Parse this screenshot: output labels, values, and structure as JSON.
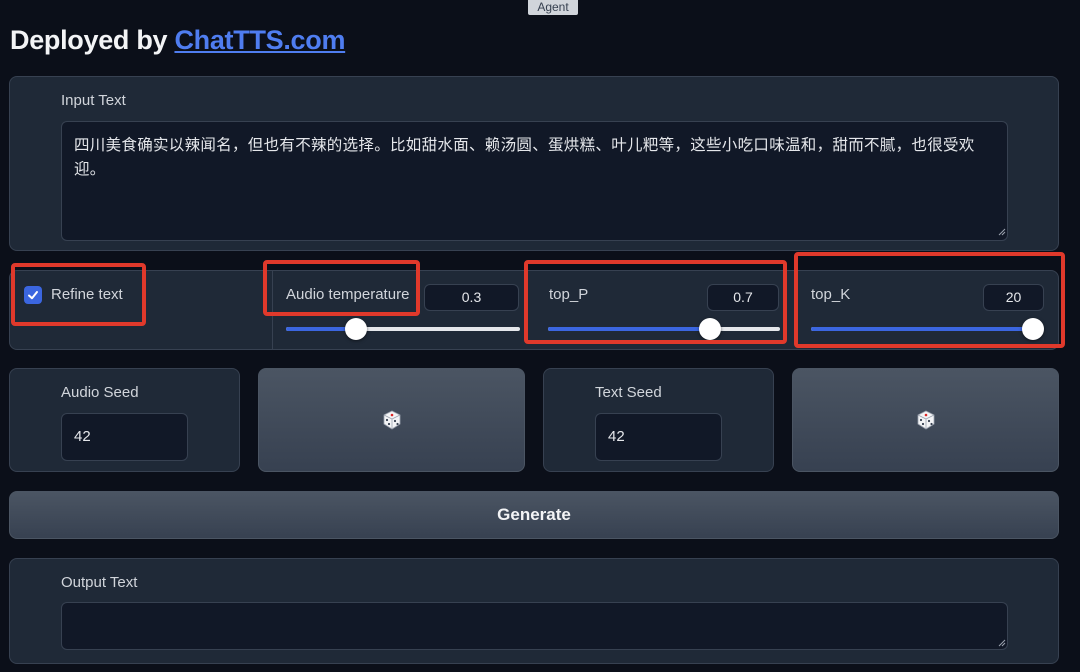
{
  "window": {
    "agent_tag": "Agent",
    "title_prefix": "Deployed by ",
    "title_link": "ChatTTS.com"
  },
  "input": {
    "label": "Input Text",
    "value": "四川美食确实以辣闻名，但也有不辣的选择。比如甜水面、赖汤圆、蛋烘糕、叶儿粑等，这些小吃口味温和，甜而不腻，也很受欢迎。"
  },
  "controls": {
    "refine_text": {
      "label": "Refine text",
      "checked": true
    },
    "audio_temperature": {
      "label": "Audio temperature",
      "value": "0.3",
      "fraction": 0.3
    },
    "top_p": {
      "label": "top_P",
      "value": "0.7",
      "fraction": 0.7
    },
    "top_k": {
      "label": "top_K",
      "value": "20",
      "fraction": 1.0
    }
  },
  "seeds": {
    "audio_seed": {
      "label": "Audio Seed",
      "value": "42"
    },
    "text_seed": {
      "label": "Text Seed",
      "value": "42"
    },
    "dice_icon": "dice-icon"
  },
  "generate_button": "Generate",
  "output": {
    "label": "Output Text",
    "value": ""
  },
  "colors": {
    "accent": "#3b66e0",
    "highlight": "#e0392b",
    "link": "#4f7df0"
  }
}
